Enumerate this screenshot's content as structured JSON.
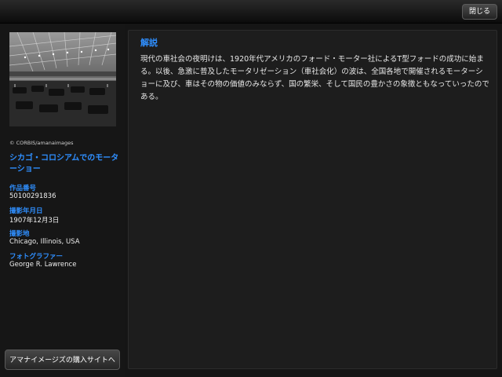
{
  "header": {
    "close_label": "閉じる"
  },
  "sidebar": {
    "credit": "© CORBIS/amanaimages",
    "title": "シカゴ・コロシアムでのモーターショー",
    "fields": [
      {
        "label": "作品番号",
        "value": "50100291836"
      },
      {
        "label": "撮影年月日",
        "value": "1907年12月3日"
      },
      {
        "label": "撮影地",
        "value": "Chicago, Illinois, USA"
      },
      {
        "label": "フォトグラファー",
        "value": "George R. Lawrence"
      }
    ],
    "buy_label": "アマナイメージズの購入サイトへ"
  },
  "main": {
    "heading": "解説",
    "body": "現代の車社会の夜明けは、1920年代アメリカのフォード・モーター社によるT型フォードの成功に始まる。以後、急激に普及したモータリゼーション（車社会化）の波は、全国各地で開催されるモーターショーに及び、車はその物の価値のみならず、国の繁栄、そして国民の豊かさの象徴ともなっていったのである。"
  }
}
